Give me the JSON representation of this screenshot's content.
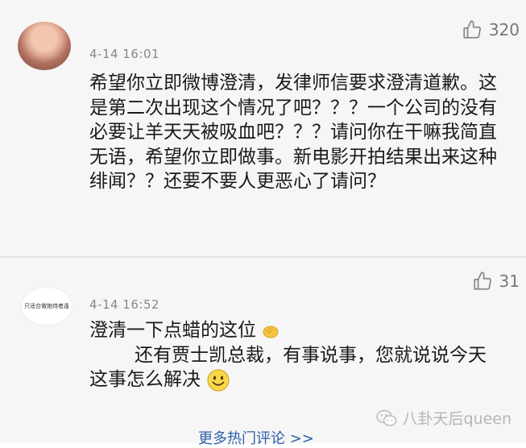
{
  "comments": [
    {
      "timestamp": "4-14 16:01",
      "likes": "320",
      "text": "希望你立即微博澄清，发律师信要求澄清道歉。这是第二次出现这个情况了吧？？？一个公司的没有必要让羊天天被吸血吧？？？请问你在干嘛我简直无语，希望你立即做事。新电影开拍结果出来这种绯闻？？还要不要人更恶心了请问？"
    },
    {
      "timestamp": "4-14 16:52",
      "likes": "31",
      "avatar_text": "只适合做她侍者逢",
      "text_line1": "澄清一下点蜡的这位",
      "text_line2": "还有贾士凯总裁，有事说事，您就说说今天这事怎么解决"
    }
  ],
  "footer": {
    "more_link": "更多热门评论 >>",
    "watermark": "八卦天后queen"
  },
  "icons": [
    "thumbs-up-icon",
    "clapping-hands-icon",
    "smile-icon",
    "wechat-icon"
  ]
}
